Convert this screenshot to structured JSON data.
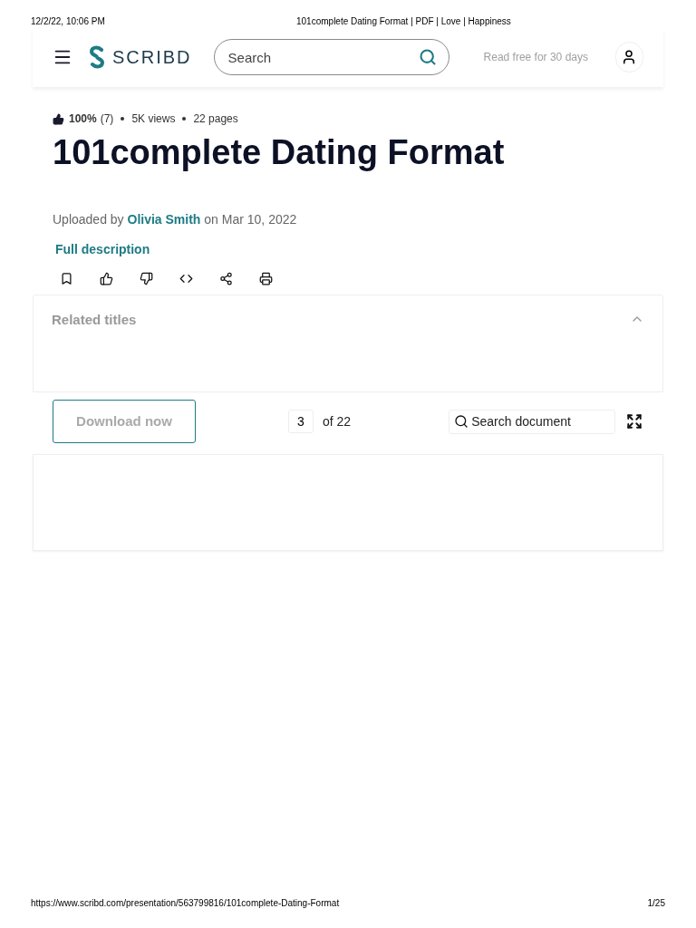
{
  "print_header": {
    "date": "12/2/22, 10:06 PM",
    "title": "101complete Dating Format | PDF | Love | Happiness"
  },
  "navbar": {
    "logo": "SCRIBD",
    "search": {
      "placeholder": "Search"
    },
    "promo": "Read free for 30 days"
  },
  "document": {
    "rating": "100%",
    "rating_count": "(7)",
    "views": "5K views",
    "pages": "22 pages",
    "title": "101complete Dating Format",
    "uploaded_prefix": "Uploaded by",
    "uploader": "Olivia Smith",
    "uploaded_suffix": "on Mar 10, 2022",
    "description_link": "Full description"
  },
  "actions": [
    {
      "kind": "save"
    },
    {
      "kind": "like"
    },
    {
      "kind": "dislike"
    },
    {
      "kind": "embed"
    },
    {
      "kind": "share"
    },
    {
      "kind": "print"
    }
  ],
  "related": {
    "title": "Related titles",
    "expanded": true
  },
  "viewer": {
    "download": "Download now",
    "page": "3",
    "page_total": "of 22",
    "search": {
      "placeholder": "Search document"
    }
  },
  "print_footer": {
    "url": "https://www.scribd.com/presentation/563799816/101complete-Dating-Format",
    "page": "1/25"
  }
}
